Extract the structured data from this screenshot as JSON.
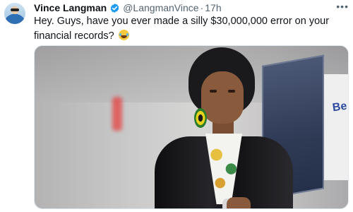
{
  "tweet": {
    "author": {
      "name": "Vince Langman",
      "handle": "@LangmanVince",
      "verified": true
    },
    "separator": "·",
    "timestamp": "17h",
    "more_icon": "more-icon",
    "text": "Hey. Guys, have you ever made a silly $30,000,000 error on your financial records?",
    "emoji": "laughing-tears-emoji",
    "media": {
      "type": "photo",
      "visible_sign_text": "Be"
    }
  },
  "colors": {
    "primary_text": "#0f1419",
    "secondary_text": "#536471",
    "verified_blue": "#1d9bf0",
    "background": "#ffffff"
  }
}
